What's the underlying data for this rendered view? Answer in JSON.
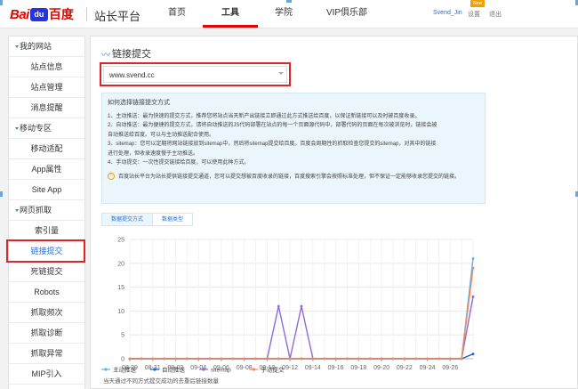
{
  "logo": {
    "bai": "Bai",
    "du": "du",
    "cn": "百度"
  },
  "header": {
    "site_title": "站长平台",
    "nav": [
      {
        "label": "首页"
      },
      {
        "label": "工具"
      },
      {
        "label": "学院"
      },
      {
        "label": "VIP俱乐部"
      }
    ],
    "user": "Svend_Jin",
    "settings": "设置",
    "logout": "退出",
    "new_badge": "New"
  },
  "sidebar": {
    "sections": [
      {
        "title": "我的网站",
        "items": [
          "站点信息",
          "站点管理",
          "消息提醒"
        ]
      },
      {
        "title": "移动专区",
        "items": [
          "移动适配",
          "App属性",
          "Site App"
        ]
      },
      {
        "title": "网页抓取",
        "items": [
          "索引量",
          "链接提交",
          "死链提交",
          "Robots",
          "抓取频次",
          "抓取诊断",
          "抓取异常",
          "MIP引入"
        ]
      }
    ],
    "active_item": "链接提交"
  },
  "main": {
    "title": "链接提交",
    "site_select": "www.svend.cc",
    "info": {
      "title": "如何选择链接提交方式",
      "lines": [
        "1、主动推送：最为快速的提交方式，推荐您将站点当天新产出链接立即通过此方式推送给百度，以保证新链接可以及时被百度收录。",
        "2、自动推送：最为便捷的提交方式，请将自动推送的JS代码部署在站点的每一个页面源代码中，部署代码的页面在每次被浏览时，链接会被",
        "自动推送给百度。可以与主动推送配合使用。",
        "3、sitemap：您可以定期将网站链接放到sitemap中，然后将sitemap提交给百度。百度会周期性的抓取检查您提交的sitemap，对其中的链接",
        "进行处理，但收录速度慢于主动推送。",
        "4、手动提交：一次性提交链接给百度，可以使用此种方式。"
      ],
      "note": "百度站长平台为站长提供链接提交通道，您可以提交想被百度收录的链接，百度搜索引擎会按照标准处理，但不保证一定能够收录您提交的链接。"
    },
    "tabs": [
      {
        "label": "数据提交方式"
      },
      {
        "label": "数据类型"
      }
    ]
  },
  "chart_data": {
    "type": "line",
    "x": [
      "08-29",
      "08-30",
      "08-31",
      "09-01",
      "09-02",
      "09-03",
      "09-04",
      "09-05",
      "09-06",
      "09-07",
      "09-08",
      "09-09",
      "09-10",
      "09-11",
      "09-12",
      "09-13",
      "09-14",
      "09-15",
      "09-16",
      "09-17",
      "09-18",
      "09-19",
      "09-20",
      "09-21",
      "09-22",
      "09-23",
      "09-24",
      "09-25",
      "09-26",
      "09-27",
      "09-28"
    ],
    "tick_labels": [
      "08-29",
      "08-31",
      "09-02",
      "09-04",
      "09-06",
      "09-08",
      "09-10",
      "09-12",
      "09-14",
      "09-16",
      "09-18",
      "09-20",
      "09-22",
      "09-24",
      "09-26"
    ],
    "ylim": [
      0,
      25
    ],
    "yticks": [
      0,
      5,
      10,
      15,
      20,
      25
    ],
    "series": [
      {
        "name": "主动推送",
        "color": "#5ab4e6",
        "values": [
          0,
          0,
          0,
          0,
          0,
          0,
          0,
          0,
          0,
          0,
          0,
          0,
          0,
          0,
          0,
          0,
          0,
          0,
          0,
          0,
          0,
          0,
          0,
          0,
          0,
          0,
          0,
          0,
          0,
          0,
          21
        ]
      },
      {
        "name": "自动推送",
        "color": "#1f5fbf",
        "values": [
          0,
          0,
          0,
          0,
          0,
          0,
          0,
          0,
          0,
          0,
          0,
          0,
          0,
          0,
          0,
          0,
          0,
          0,
          0,
          0,
          0,
          0,
          0,
          0,
          0,
          0,
          0,
          0,
          0,
          0,
          1
        ]
      },
      {
        "name": "sitemap",
        "color": "#8e6ad8",
        "values": [
          0,
          0,
          0,
          0,
          0,
          0,
          0,
          0,
          0,
          0,
          0,
          0,
          0,
          11,
          0,
          11,
          0,
          0,
          0,
          0,
          0,
          0,
          0,
          0,
          0,
          0,
          0,
          0,
          0,
          0,
          13
        ]
      },
      {
        "name": "手动提交",
        "color": "#f08a5d",
        "values": [
          0,
          0,
          0,
          0,
          0,
          0,
          0,
          0,
          0,
          0,
          0,
          0,
          0,
          0,
          0,
          0,
          0,
          0,
          0,
          0,
          0,
          0,
          0,
          0,
          0,
          0,
          0,
          0,
          0,
          0,
          19
        ]
      }
    ],
    "footnote": "当天通过不同方式提交成功的去重后链接数量",
    "legend_position": "bottom-left"
  }
}
